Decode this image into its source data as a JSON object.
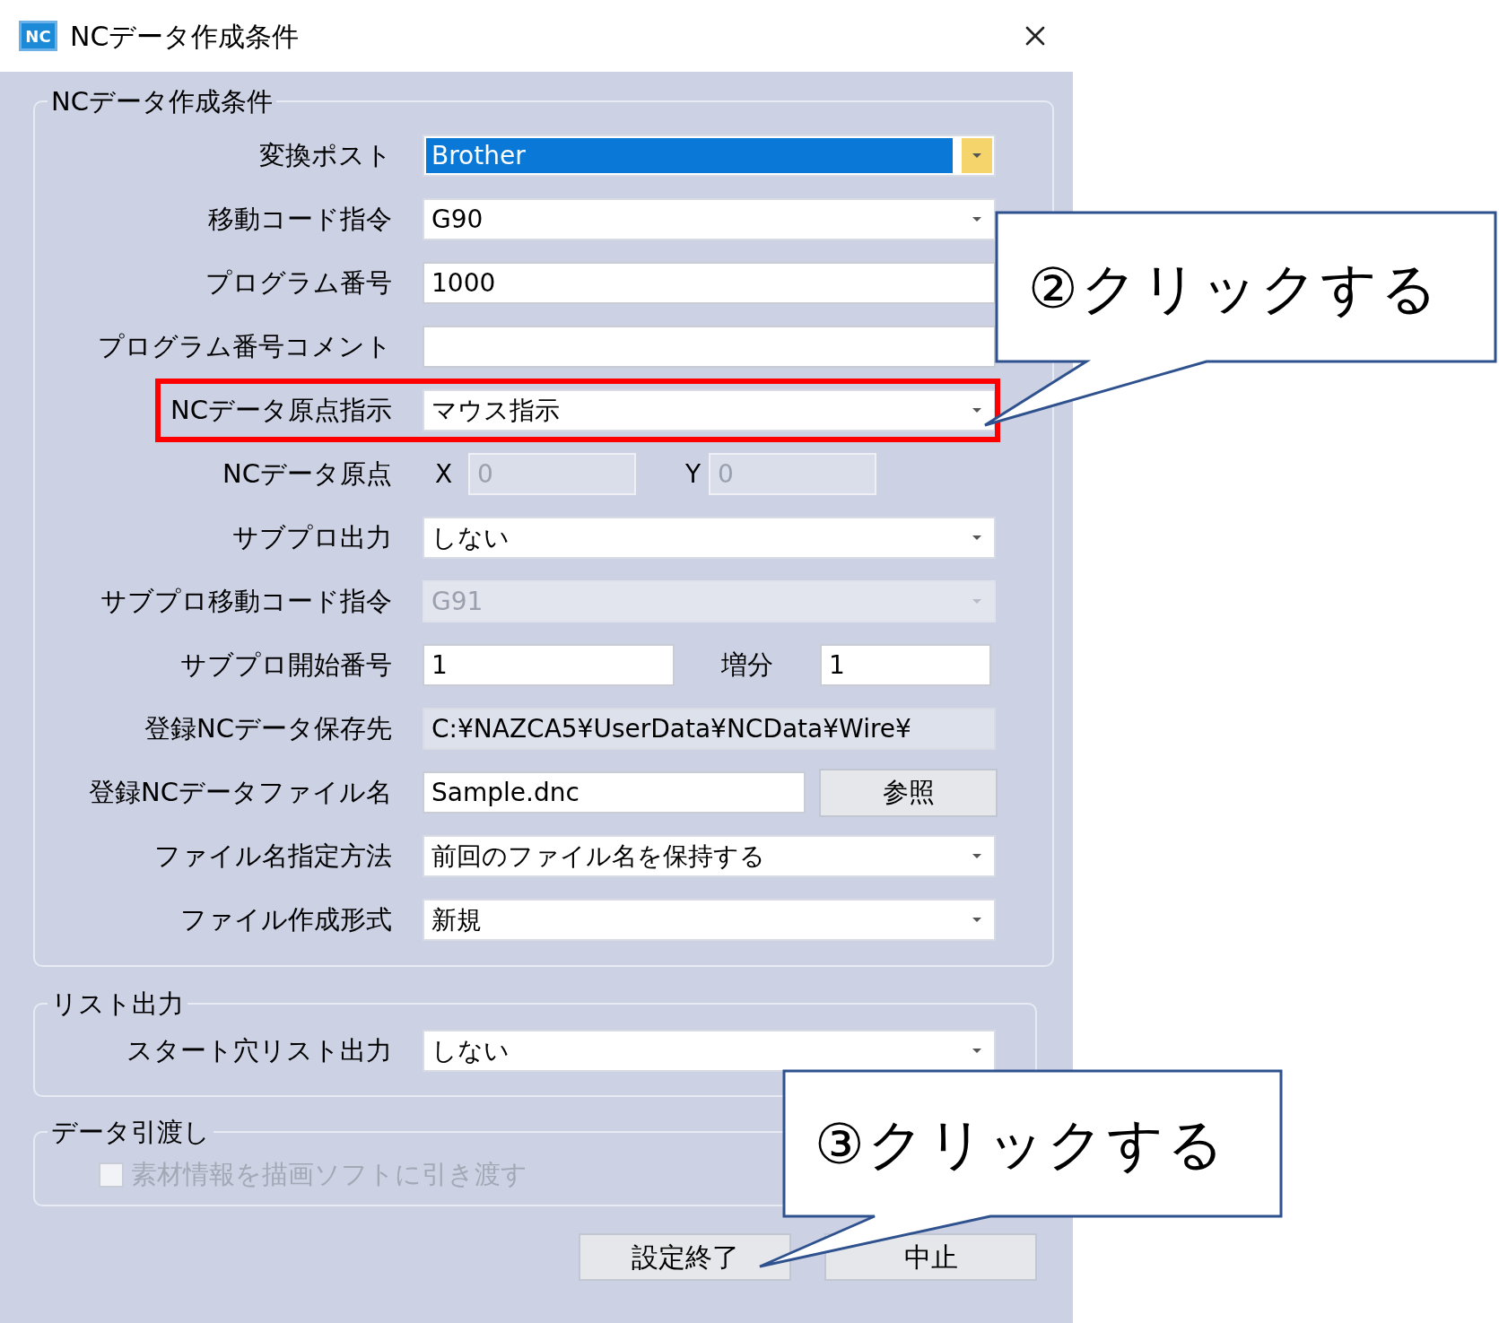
{
  "window": {
    "title": "NCデータ作成条件",
    "icon_text": "NC"
  },
  "groups": [
    {
      "title": "NCデータ作成条件",
      "rows": [
        {
          "kind": "dropdown",
          "label": "変換ポスト",
          "value": "Brother",
          "focused": true,
          "disabled": false,
          "marked": false
        },
        {
          "kind": "dropdown",
          "label": "移動コード指令",
          "value": "G90",
          "focused": false,
          "disabled": false,
          "marked": false
        },
        {
          "kind": "text",
          "label": "プログラム番号",
          "value": "1000",
          "disabled": false
        },
        {
          "kind": "text",
          "label": "プログラム番号コメント",
          "disabled": false
        },
        {
          "kind": "dropdown",
          "label": "NCデータ原点指示",
          "value": "マウス指示",
          "focused": false,
          "disabled": false,
          "marked": true
        },
        {
          "kind": "xy",
          "label": "NCデータ原点",
          "x_label": "X",
          "x_value": "0",
          "y_label": "Y",
          "y_value": "0",
          "disabled": true
        },
        {
          "kind": "dropdown",
          "label": "サブプロ出力",
          "value": "しない",
          "focused": false,
          "disabled": false,
          "marked": false
        },
        {
          "kind": "dropdown",
          "label": "サブプロ移動コード指令",
          "value": "G91",
          "focused": false,
          "disabled": true,
          "marked": false
        },
        {
          "kind": "pair",
          "label": "サブプロ開始番号",
          "value": "1",
          "second_label": "増分",
          "second_value": "1"
        },
        {
          "kind": "readonly",
          "label": "登録NCデータ保存先",
          "value": "C:¥NAZCA5¥UserData¥NCData¥Wire¥"
        },
        {
          "kind": "file",
          "label": "登録NCデータファイル名",
          "value": "Sample.dnc",
          "button": "参照"
        },
        {
          "kind": "dropdown",
          "label": "ファイル名指定方法",
          "value": "前回のファイル名を保持する",
          "focused": false,
          "disabled": false,
          "marked": false
        },
        {
          "kind": "dropdown",
          "label": "ファイル作成形式",
          "value": "新規",
          "focused": false,
          "disabled": false,
          "marked": false
        }
      ]
    },
    {
      "title": "リスト出力",
      "rows": [
        {
          "kind": "dropdown",
          "label": "スタート穴リスト出力",
          "value": "しない",
          "focused": false,
          "disabled": false,
          "marked": false
        }
      ]
    },
    {
      "title": "データ引渡し",
      "rows": [
        {
          "kind": "checkbox",
          "label": "素材情報を描画ソフトに引き渡す",
          "checked": false,
          "disabled": true
        }
      ]
    }
  ],
  "buttons": [
    "設定終了",
    "中止"
  ],
  "callouts": [
    {
      "text": "②クリックする"
    },
    {
      "text": "③クリックする"
    }
  ]
}
